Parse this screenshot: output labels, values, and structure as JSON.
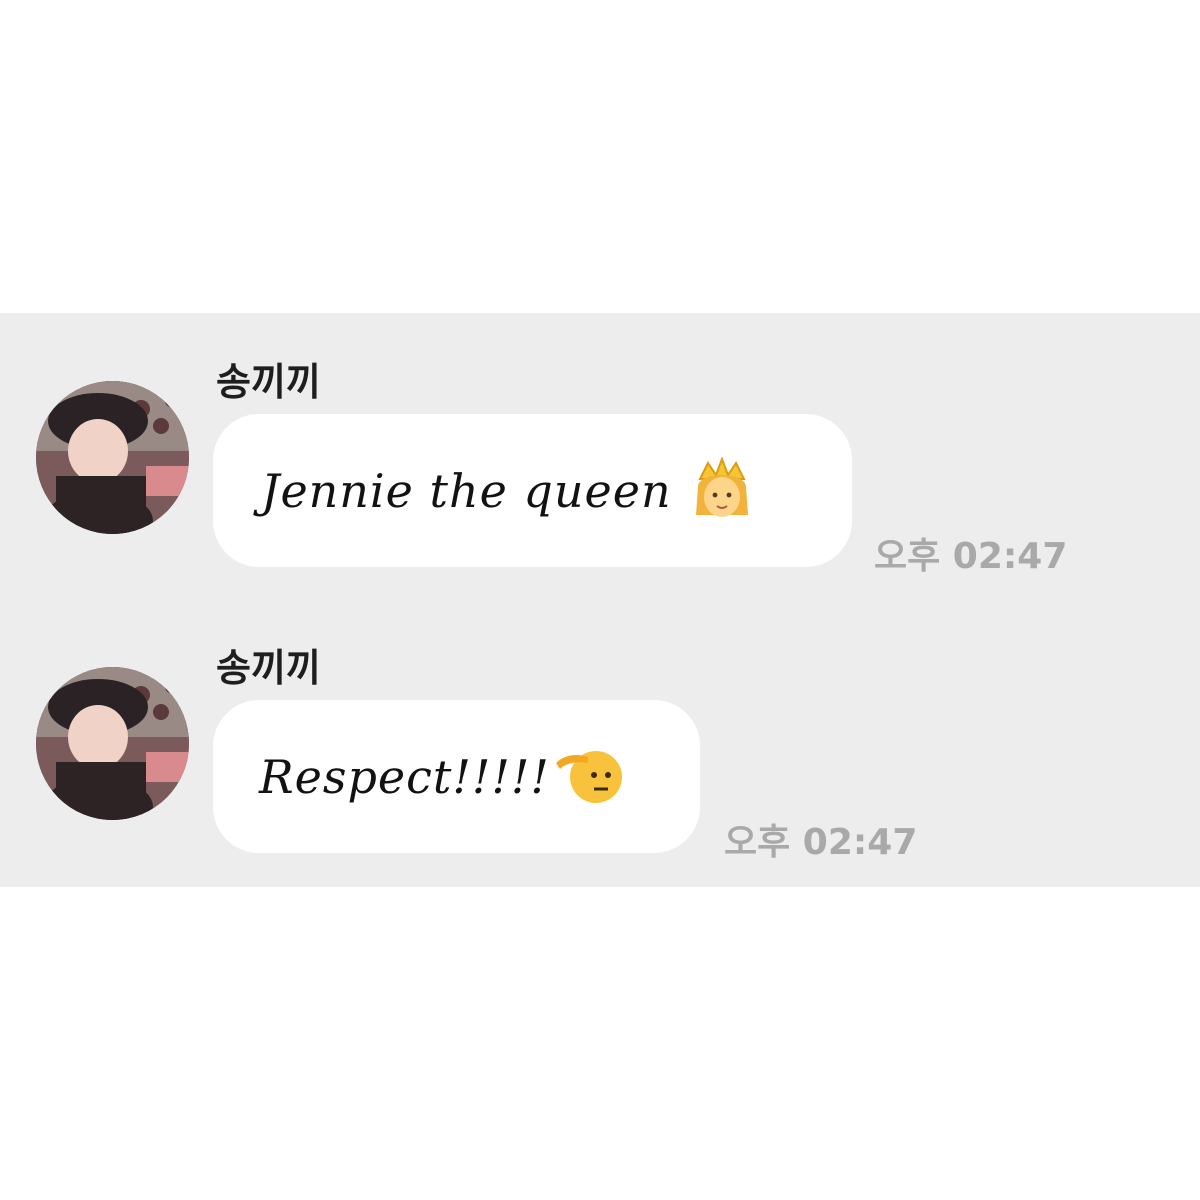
{
  "chat": {
    "messages": [
      {
        "sender": "송끼끼",
        "text": "Jennie the queen",
        "emoji": "princess-emoji",
        "time": "오후 02:47"
      },
      {
        "sender": "송끼끼",
        "text": "Respect!!!!!",
        "emoji": "saluting-face-emoji",
        "time": "오후 02:47"
      }
    ]
  },
  "colors": {
    "chat_background": "#ededed",
    "bubble": "#ffffff",
    "time_text": "#a9a9a9"
  }
}
